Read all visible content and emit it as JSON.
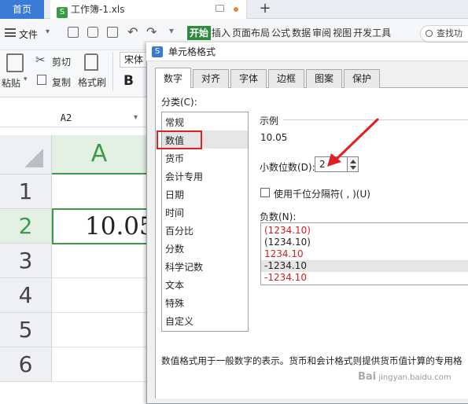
{
  "tabs": {
    "home": "首页",
    "file": "工作簿-1.xls",
    "file_icon": "S"
  },
  "menubar": {
    "file_menu": "文件",
    "ribbon_tabs": [
      "开始",
      "插入",
      "页面布局",
      "公式",
      "数据",
      "审阅",
      "视图",
      "开发工具"
    ],
    "search": "查找功"
  },
  "ribbon": {
    "paste": "粘贴",
    "cut": "剪切",
    "copy": "复制",
    "format_painter": "格式刷",
    "font_name": "宋体",
    "bold": "B"
  },
  "namebox": "A2",
  "sheet": {
    "column_header": "A",
    "rows": [
      "1",
      "2",
      "3",
      "4",
      "5",
      "6"
    ],
    "cell_a2": "10.05"
  },
  "dialog": {
    "title": "单元格格式",
    "icon_letter": "S",
    "tabs": [
      "数字",
      "对齐",
      "字体",
      "边框",
      "图案",
      "保护"
    ],
    "category_label": "分类(C):",
    "categories": [
      "常规",
      "数值",
      "货币",
      "会计专用",
      "日期",
      "时间",
      "百分比",
      "分数",
      "科学记数",
      "文本",
      "特殊",
      "自定义"
    ],
    "selected_category": "数值",
    "sample_label": "示例",
    "sample_value": "10.05",
    "decimal_label": "小数位数(D):",
    "decimal_value": "2",
    "thousands_label": "使用千位分隔符( , )(U)",
    "negative_label": "负数(N):",
    "negative_formats": [
      {
        "text": "(1234.10)",
        "color": "#d21f1f"
      },
      {
        "text": "(1234.10)",
        "color": "#222222"
      },
      {
        "text": "1234.10",
        "color": "#d21f1f"
      },
      {
        "text": "-1234.10",
        "color": "#222222"
      },
      {
        "text": "-1234.10",
        "color": "#d21f1f"
      }
    ],
    "description": "数值格式用于一般数字的表示。货币和会计格式则提供货币值计算的专用格"
  },
  "colors": {
    "accent_green": "#3c9a4a",
    "highlight_red": "#e02020",
    "brand_blue": "#3b7bd8"
  },
  "watermark": {
    "brand": "Bai",
    "site": "jingyan.baidu.com"
  }
}
